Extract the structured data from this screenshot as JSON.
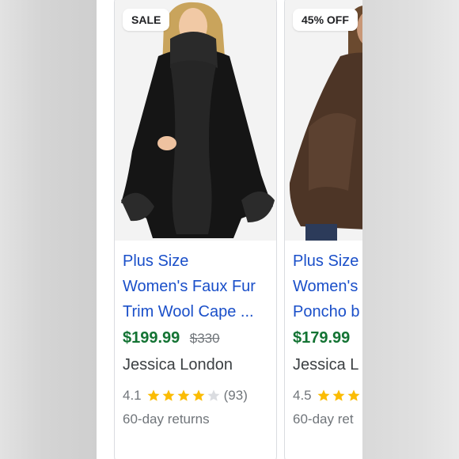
{
  "colors": {
    "title_link": "#1a4fc9",
    "price": "#137333",
    "muted": "#70757a",
    "store": "#3c4043",
    "star_filled": "#fbbc04",
    "star_empty": "#dadce0"
  },
  "products": [
    {
      "badge": "SALE",
      "title_lines": [
        "Plus Size",
        "Women's Faux Fur",
        "Trim Wool Cape ..."
      ],
      "price": "$199.99",
      "old_price": "$330",
      "store": "Jessica London",
      "rating": "4.1",
      "rating_value": 4.1,
      "reviews": "(93)",
      "returns": "60-day returns",
      "image_icon": "black-fur-trim-cape"
    },
    {
      "badge": "45% OFF",
      "title_lines": [
        "Plus Size",
        "Women's",
        "Poncho b"
      ],
      "price": "$179.99",
      "old_price": "",
      "store": "Jessica L",
      "rating": "4.5",
      "rating_value": 4.5,
      "reviews": "",
      "returns": "60-day ret",
      "image_icon": "brown-leather-poncho"
    }
  ]
}
